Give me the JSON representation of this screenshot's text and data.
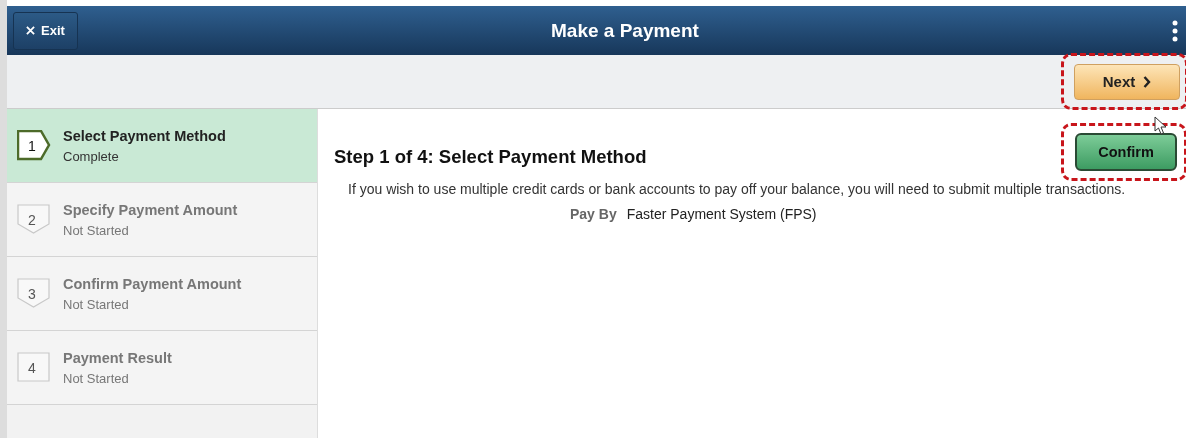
{
  "header": {
    "exit_label": "Exit",
    "title": "Make a Payment"
  },
  "toolbar": {
    "next_label": "Next",
    "highlighted": true
  },
  "steps": [
    {
      "number": "1",
      "title": "Select Payment Method",
      "status": "Complete",
      "selected": true,
      "kind": "arrow-right"
    },
    {
      "number": "2",
      "title": "Specify Payment Amount",
      "status": "Not Started",
      "selected": false,
      "kind": "arrow-down"
    },
    {
      "number": "3",
      "title": "Confirm Payment Amount",
      "status": "Not Started",
      "selected": false,
      "kind": "arrow-down"
    },
    {
      "number": "4",
      "title": "Payment Result",
      "status": "Not Started",
      "selected": false,
      "kind": "square"
    }
  ],
  "content": {
    "heading": "Step 1 of 4: Select Payment Method",
    "confirm_label": "Confirm",
    "confirm_highlighted": true,
    "note": "If you wish to use multiple credit cards or bank accounts to pay off your balance, you will need to submit multiple transactions.",
    "pay_by_label": "Pay By",
    "pay_by_value": "Faster Payment System (FPS)"
  }
}
